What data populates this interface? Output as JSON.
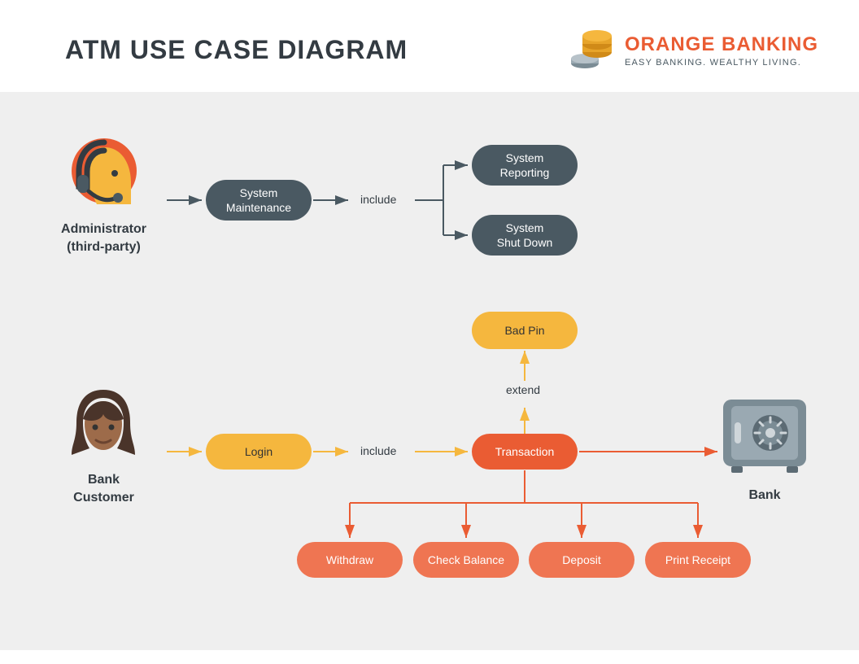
{
  "header": {
    "title": "ATM USE CASE DIAGRAM",
    "brand_name": "ORANGE BANKING",
    "brand_tagline": "EASY BANKING. WEALTHY LIVING."
  },
  "actors": {
    "admin": {
      "label_line1": "Administrator",
      "label_line2": "(third-party)"
    },
    "customer": {
      "label_line1": "Bank",
      "label_line2": "Customer"
    },
    "bank": {
      "label": "Bank"
    }
  },
  "nodes": {
    "system_maintenance": {
      "line1": "System",
      "line2": "Maintenance"
    },
    "system_reporting": {
      "line1": "System",
      "line2": "Reporting"
    },
    "system_shutdown": {
      "line1": "System",
      "line2": "Shut Down"
    },
    "bad_pin": {
      "text": "Bad Pin"
    },
    "login": {
      "text": "Login"
    },
    "transaction": {
      "text": "Transaction"
    },
    "withdraw": {
      "text": "Withdraw"
    },
    "check_balance": {
      "text": "Check Balance"
    },
    "deposit": {
      "text": "Deposit"
    },
    "print_receipt": {
      "text": "Print Receipt"
    }
  },
  "relations": {
    "include1": "include",
    "include2": "include",
    "extend": "extend"
  }
}
